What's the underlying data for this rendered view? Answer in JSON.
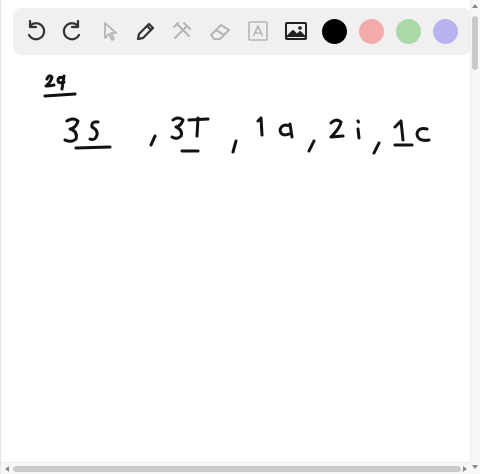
{
  "toolbar": {
    "tools": [
      {
        "name": "undo-icon"
      },
      {
        "name": "redo-icon"
      },
      {
        "name": "select-pointer-icon"
      },
      {
        "name": "pen-icon"
      },
      {
        "name": "tools-icon"
      },
      {
        "name": "eraser-icon"
      },
      {
        "name": "text-tool-icon"
      },
      {
        "name": "image-icon"
      }
    ],
    "colors": [
      {
        "name": "black",
        "hex": "#000000"
      },
      {
        "name": "red",
        "hex": "#f2aaaa"
      },
      {
        "name": "green",
        "hex": "#a9d8a9"
      },
      {
        "name": "purple",
        "hex": "#b8b2ee"
      }
    ]
  },
  "canvas": {
    "handwriting": [
      "29",
      "3s",
      "3t",
      "1a",
      "2i",
      "1c"
    ]
  }
}
